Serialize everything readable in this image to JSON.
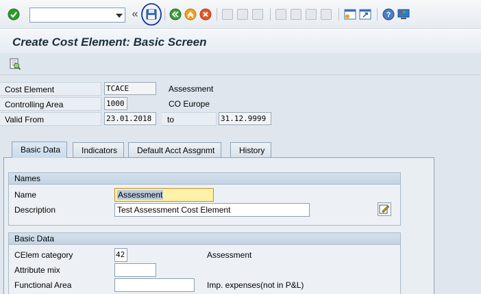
{
  "toolbar": {
    "command_value": "",
    "nav_back": "«",
    "icons": [
      "check-icon",
      "save-icon",
      "back-icon",
      "exit-icon",
      "cancel-icon",
      "print-icon",
      "find-icon",
      "find-next-icon",
      "first-page-icon",
      "previous-page-icon",
      "next-page-icon",
      "last-page-icon",
      "create-session-icon",
      "shortcut-icon",
      "help-icon",
      "layout-menu-icon"
    ]
  },
  "title": "Create Cost Element: Basic Screen",
  "header": {
    "cost_element_label": "Cost Element",
    "cost_element_value": "TCACE",
    "cost_element_desc": "Assessment",
    "controlling_area_label": "Controlling Area",
    "controlling_area_value": "1000",
    "controlling_area_desc": "CO Europe",
    "valid_from_label": "Valid From",
    "valid_from_value": "23.01.2018",
    "to_label": "to",
    "valid_to_value": "31.12.9999"
  },
  "tabs": [
    {
      "label": "Basic Data"
    },
    {
      "label": "Indicators"
    },
    {
      "label": "Default Acct Assgnmt"
    },
    {
      "label": "History"
    }
  ],
  "names_group": {
    "title": "Names",
    "name_label": "Name",
    "name_value": "Assessment",
    "description_label": "Description",
    "description_value": "Test Assessment Cost Element"
  },
  "basic_group": {
    "title": "Basic Data",
    "category_label": "CElem category",
    "category_value": "42",
    "category_desc": "Assessment",
    "attribute_label": "Attribute mix",
    "attribute_value": "",
    "functional_label": "Functional Area",
    "functional_value": "",
    "functional_desc": "Imp. expenses(not in P&L)"
  },
  "colors": {
    "accent": "#0f2fa8",
    "ok_green": "#2e9a2e",
    "exit_orange": "#f0a020",
    "cancel_red": "#e05a2a",
    "field_highlight": "#fff2a8"
  }
}
